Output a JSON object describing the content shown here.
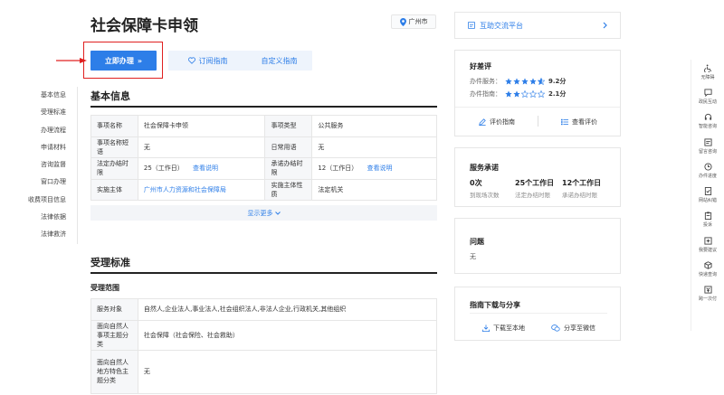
{
  "header": {
    "title": "社会保障卡申领",
    "city": "广州市"
  },
  "actions": {
    "apply": "立即办理",
    "apply_suffix": "»",
    "subscribe": "订阅指南",
    "custom": "自定义指南"
  },
  "nav": {
    "items": [
      "基本信息",
      "受理标准",
      "办理流程",
      "申请材料",
      "咨询监督",
      "窗口办理",
      "收费项目信息",
      "法律依据",
      "法律救济"
    ]
  },
  "basic": {
    "title": "基本信息",
    "rows": [
      {
        "l1": "事项名称",
        "v1": "社会保障卡申领",
        "l2": "事项类型",
        "v2": "公共服务"
      },
      {
        "l1": "事项名称短语",
        "v1": "无",
        "l2": "日常用语",
        "v2": "无"
      },
      {
        "l1": "法定办结时限",
        "v1": "25（工作日）",
        "link1": "查看说明",
        "l2": "承诺办结时限",
        "v2": "12（工作日）",
        "link2": "查看说明"
      },
      {
        "l1": "实施主体",
        "v1": "广州市人力资源和社会保障局",
        "l2": "实施主体性质",
        "v2": "法定机关"
      }
    ],
    "more": "显示更多"
  },
  "acceptance": {
    "title": "受理标准",
    "subtitle": "受理范围",
    "rows": [
      {
        "label": "服务对象",
        "value": "自然人,企业法人,事业法人,社会组织法人,非法人企业,行政机关,其他组织"
      },
      {
        "label": "面向自然人事项主题分类",
        "value": "社会保障（社会保险、社会救助）"
      },
      {
        "label": "面向自然人地方特色主题分类",
        "value": "无"
      }
    ]
  },
  "right": {
    "platform": "互助交流平台",
    "rating": {
      "title": "好差评",
      "service_label": "办件服务：",
      "service_score": "9.2分",
      "guide_label": "办件指南：",
      "guide_score": "2.1分",
      "evaluate": "评价指南",
      "view": "查看评价"
    },
    "promise": {
      "title": "服务承诺",
      "items": [
        {
          "value": "0次",
          "label": "到现场次数"
        },
        {
          "value": "25个工作日",
          "label": "法定办结时限"
        },
        {
          "value": "12个工作日",
          "label": "承诺办结时限"
        }
      ]
    },
    "question": {
      "title": "问题",
      "value": "无"
    },
    "download": {
      "title": "指南下载与分享",
      "local": "下载至本地",
      "wechat": "分享至微信"
    }
  },
  "toolbar": {
    "items": [
      "无障碍",
      "政民互动",
      "智能咨询",
      "留言咨询",
      "办件进度",
      "网站纠错",
      "投诉",
      "我要建议",
      "快递查询",
      "跨一次付"
    ]
  },
  "colors": {
    "primary": "#2d7ee8",
    "highlight": "#e02020",
    "star": "#2d7ee8"
  }
}
